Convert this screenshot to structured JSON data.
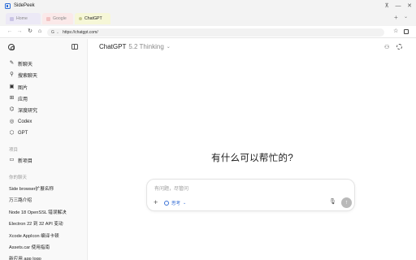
{
  "window": {
    "title": "SidePeek"
  },
  "tabs": [
    {
      "label": "Home",
      "active": false
    },
    {
      "label": "Google",
      "active": false
    },
    {
      "label": "ChatGPT",
      "active": true
    }
  ],
  "toolbar": {
    "url_prefix": "G",
    "url": "https://chatgpt.com/"
  },
  "sidebar": {
    "nav_items": [
      {
        "label": "新聊天",
        "icon": "edit-icon"
      },
      {
        "label": "搜索聊天",
        "icon": "search-icon"
      },
      {
        "label": "图片",
        "icon": "image-icon"
      },
      {
        "label": "应用",
        "icon": "apps-icon"
      },
      {
        "label": "深度研究",
        "icon": "research-icon"
      },
      {
        "label": "Codex",
        "icon": "codex-icon"
      },
      {
        "label": "GPT",
        "icon": "gpt-icon"
      }
    ],
    "projects_heading": "项目",
    "new_project": "新项目",
    "chats_heading": "你的聊天",
    "chats": [
      "Side browser扩展名称",
      "万三路介绍",
      "Node 18 OpenSSL 错误解决",
      "Electron 22 到 32 API 变动",
      "Xcode AppIcon 编译卡顿",
      "Assets.car 使用指南",
      "新应用 app logo"
    ]
  },
  "main": {
    "model_name": "ChatGPT",
    "model_version": "5.2 Thinking",
    "headline": "有什么可以帮忙的?",
    "composer": {
      "placeholder": "有问题，尽管问",
      "mode_label": "思考"
    }
  },
  "colors": {
    "accent": "#3a72d6",
    "tab_home": "#ece9f6",
    "tab_google": "#fbe9e9",
    "tab_chatgpt": "#f6f7d7"
  }
}
